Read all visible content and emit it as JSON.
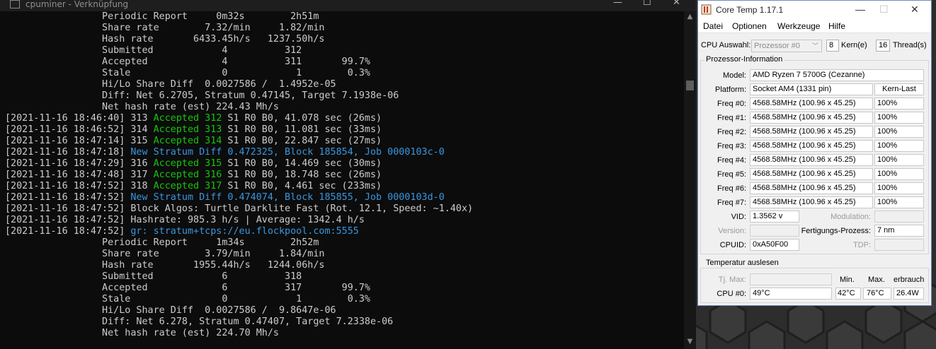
{
  "console": {
    "title": "cpuminer - Verknüpfung",
    "lines": [
      [
        {
          "t": "                 Periodic Report     0m32s        2h51m"
        }
      ],
      [
        {
          "t": "                 Share rate        7.32/min     1.82/min"
        }
      ],
      [
        {
          "t": "                 Hash rate       6433.45h/s   1237.50h/s"
        }
      ],
      [
        {
          "t": "                 Submitted            4          312"
        }
      ],
      [
        {
          "t": "                 Accepted             4          311       99.7%"
        }
      ],
      [
        {
          "t": "                 Stale                0            1        0.3%"
        }
      ],
      [
        {
          "t": "                 Hi/Lo Share Diff  0.0027586 /  1.4952e-05"
        }
      ],
      [
        {
          "t": "                 Diff: Net 6.2705, Stratum 0.47145, Target 7.1938e-06"
        }
      ],
      [
        {
          "t": "                 Net hash rate (est) 224.43 Mh/s"
        }
      ],
      [
        {
          "t": "[2021-11-16 18:46:40] 313 "
        },
        {
          "t": "Accepted 312",
          "c": "green"
        },
        {
          "t": " S1 R0 B0, 41.078 sec (26ms)"
        }
      ],
      [
        {
          "t": "[2021-11-16 18:46:52] 314 "
        },
        {
          "t": "Accepted 313",
          "c": "green"
        },
        {
          "t": " S1 R0 B0, 11.081 sec (33ms)"
        }
      ],
      [
        {
          "t": "[2021-11-16 18:47:14] 315 "
        },
        {
          "t": "Accepted 314",
          "c": "green"
        },
        {
          "t": " S1 R0 B0, 22.847 sec (27ms)"
        }
      ],
      [
        {
          "t": "[2021-11-16 18:47:18] "
        },
        {
          "t": "New Stratum Diff 0.472325, Block 185854, Job 0000103c-0",
          "c": "blue"
        }
      ],
      [
        {
          "t": "[2021-11-16 18:47:29] 316 "
        },
        {
          "t": "Accepted 315",
          "c": "green"
        },
        {
          "t": " S1 R0 B0, 14.469 sec (30ms)"
        }
      ],
      [
        {
          "t": "[2021-11-16 18:47:48] 317 "
        },
        {
          "t": "Accepted 316",
          "c": "green"
        },
        {
          "t": " S1 R0 B0, 18.748 sec (26ms)"
        }
      ],
      [
        {
          "t": "[2021-11-16 18:47:52] 318 "
        },
        {
          "t": "Accepted 317",
          "c": "green"
        },
        {
          "t": " S1 R0 B0, 4.461 sec (233ms)"
        }
      ],
      [
        {
          "t": "[2021-11-16 18:47:52] "
        },
        {
          "t": "New Stratum Diff 0.474074, Block 185855, Job 0000103d-0",
          "c": "blue"
        }
      ],
      [
        {
          "t": "[2021-11-16 18:47:52] Block Algos: Turtle Darklite Fast (Rot. 12.1, Speed: ~1.40x)"
        }
      ],
      [
        {
          "t": "[2021-11-16 18:47:52] Hashrate: 985.3 h/s | Average: 1342.4 h/s"
        }
      ],
      [
        {
          "t": "[2021-11-16 18:47:52] "
        },
        {
          "t": "gr: stratum+tcps://eu.flockpool.com:5555",
          "c": "blue"
        }
      ],
      [
        {
          "t": "                 Periodic Report     1m34s        2h52m"
        }
      ],
      [
        {
          "t": "                 Share rate        3.79/min     1.84/min"
        }
      ],
      [
        {
          "t": "                 Hash rate       1955.44h/s   1244.06h/s"
        }
      ],
      [
        {
          "t": "                 Submitted            6          318"
        }
      ],
      [
        {
          "t": "                 Accepted             6          317       99.7%"
        }
      ],
      [
        {
          "t": "                 Stale                0            1        0.3%"
        }
      ],
      [
        {
          "t": "                 Hi/Lo Share Diff  0.0027586 /  9.8647e-06"
        }
      ],
      [
        {
          "t": "                 Diff: Net 6.278, Stratum 0.47407, Target 7.2338e-06"
        }
      ],
      [
        {
          "t": "                 Net hash rate (est) 224.70 Mh/s"
        }
      ]
    ]
  },
  "coretemp": {
    "title": "Core Temp 1.17.1",
    "menu": [
      "Datei",
      "Optionen",
      "Werkzeuge",
      "Hilfe"
    ],
    "cpu_select_label": "CPU Auswahl:",
    "cpu_select_value": "Prozessor #0",
    "cores": "8",
    "cores_label": "Kern(e)",
    "threads": "16",
    "threads_label": "Thread(s)",
    "proc_group_title": "Prozessor-Information",
    "model_label": "Model:",
    "model": "AMD Ryzen 7 5700G (Cezanne)",
    "platform_label": "Platform:",
    "platform": "Socket AM4 (1331 pin)",
    "load_header": "Kern-Last",
    "freqs": [
      {
        "label": "Freq #0:",
        "value": "4568.58MHz (100.96 x 45.25)",
        "load": "100%"
      },
      {
        "label": "Freq #1:",
        "value": "4568.58MHz (100.96 x 45.25)",
        "load": "100%"
      },
      {
        "label": "Freq #2:",
        "value": "4568.58MHz (100.96 x 45.25)",
        "load": "100%"
      },
      {
        "label": "Freq #3:",
        "value": "4568.58MHz (100.96 x 45.25)",
        "load": "100%"
      },
      {
        "label": "Freq #4:",
        "value": "4568.58MHz (100.96 x 45.25)",
        "load": "100%"
      },
      {
        "label": "Freq #5:",
        "value": "4568.58MHz (100.96 x 45.25)",
        "load": "100%"
      },
      {
        "label": "Freq #6:",
        "value": "4568.58MHz (100.96 x 45.25)",
        "load": "100%"
      },
      {
        "label": "Freq #7:",
        "value": "4568.58MHz (100.96 x 45.25)",
        "load": "100%"
      }
    ],
    "vid_label": "VID:",
    "vid": "1.3562 v",
    "modulation_label": "Modulation:",
    "version_label": "Version:",
    "process_label": "Fertigungs-Prozess:",
    "process": "7 nm",
    "cpuid_label": "CPUID:",
    "cpuid": "0xA50F00",
    "tdp_label": "TDP:",
    "temp_group_title": "Temperatur auslesen",
    "tjmax_label": "Tj. Max:",
    "min_header": "Min.",
    "max_header": "Max.",
    "power_header": "erbrauch",
    "core0_label": "CPU #0:",
    "core0_temp": "49°C",
    "core0_min": "42°C",
    "core0_max": "76°C",
    "core0_power": "26.4W"
  }
}
